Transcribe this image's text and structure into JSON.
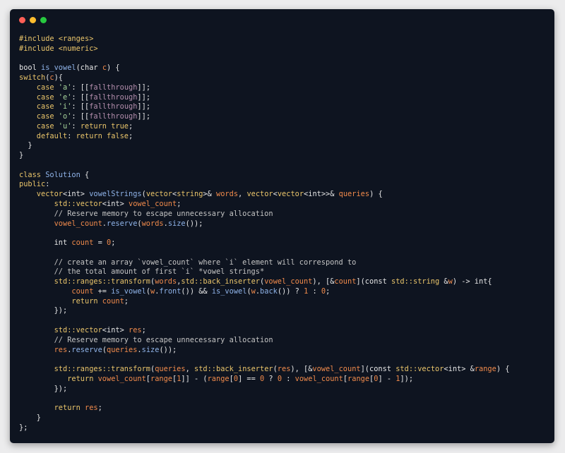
{
  "colors": {
    "background": "#ececed",
    "editor_background": "#0e1420",
    "traffic_red": "#ff5f56",
    "traffic_yellow": "#ffbd2e",
    "traffic_green": "#27c93f"
  },
  "window_controls": [
    "close",
    "minimize",
    "maximize"
  ],
  "code_lines": [
    [
      [
        "#include <ranges>",
        "kw"
      ]
    ],
    [
      [
        "#include <numeric>",
        "kw"
      ]
    ],
    [],
    [
      [
        "bool ",
        "def"
      ],
      [
        "is_vowel",
        "fn"
      ],
      [
        "(char ",
        "def"
      ],
      [
        "c",
        "var"
      ],
      [
        ") {",
        "def"
      ]
    ],
    [
      [
        "switch",
        "kw"
      ],
      [
        "(",
        "def"
      ],
      [
        "c",
        "var"
      ],
      [
        "){",
        "def"
      ]
    ],
    [
      [
        "    case ",
        "kw"
      ],
      [
        "'a'",
        "str"
      ],
      [
        ": [[",
        "def"
      ],
      [
        "fallthrough",
        "attr"
      ],
      [
        "]];",
        "def"
      ]
    ],
    [
      [
        "    case ",
        "kw"
      ],
      [
        "'e'",
        "str"
      ],
      [
        ": [[",
        "def"
      ],
      [
        "fallthrough",
        "attr"
      ],
      [
        "]];",
        "def"
      ]
    ],
    [
      [
        "    case ",
        "kw"
      ],
      [
        "'i'",
        "str"
      ],
      [
        ": [[",
        "def"
      ],
      [
        "fallthrough",
        "attr"
      ],
      [
        "]];",
        "def"
      ]
    ],
    [
      [
        "    case ",
        "kw"
      ],
      [
        "'o'",
        "str"
      ],
      [
        ": [[",
        "def"
      ],
      [
        "fallthrough",
        "attr"
      ],
      [
        "]];",
        "def"
      ]
    ],
    [
      [
        "    case ",
        "kw"
      ],
      [
        "'u'",
        "str"
      ],
      [
        ": ",
        "def"
      ],
      [
        "return true",
        "kw"
      ],
      [
        ";",
        "def"
      ]
    ],
    [
      [
        "    default",
        "kw"
      ],
      [
        ": ",
        "def"
      ],
      [
        "return false",
        "kw"
      ],
      [
        ";",
        "def"
      ]
    ],
    [
      [
        "  }",
        "def"
      ]
    ],
    [
      [
        "}",
        "def"
      ]
    ],
    [],
    [
      [
        "class ",
        "kw"
      ],
      [
        "Solution",
        "fn"
      ],
      [
        " {",
        "def"
      ]
    ],
    [
      [
        "public",
        "kw"
      ],
      [
        ":",
        "def"
      ]
    ],
    [
      [
        "    vector",
        "ns"
      ],
      [
        "<int> ",
        "def"
      ],
      [
        "vowelStrings",
        "fn"
      ],
      [
        "(",
        "def"
      ],
      [
        "vector",
        "ns"
      ],
      [
        "<",
        "def"
      ],
      [
        "string",
        "ns"
      ],
      [
        ">& ",
        "def"
      ],
      [
        "words",
        "var"
      ],
      [
        ", ",
        "def"
      ],
      [
        "vector",
        "ns"
      ],
      [
        "<",
        "def"
      ],
      [
        "vector",
        "ns"
      ],
      [
        "<int>>& ",
        "def"
      ],
      [
        "queries",
        "var"
      ],
      [
        ") {",
        "def"
      ]
    ],
    [
      [
        "        std::vector",
        "ns"
      ],
      [
        "<int> ",
        "def"
      ],
      [
        "vowel_count",
        "var"
      ],
      [
        ";",
        "def"
      ]
    ],
    [
      [
        "        // Reserve memory to escape unnecessary allocation",
        "cm"
      ]
    ],
    [
      [
        "        vowel_count",
        "var"
      ],
      [
        ".",
        "def"
      ],
      [
        "reserve",
        "fn"
      ],
      [
        "(",
        "def"
      ],
      [
        "words",
        "var"
      ],
      [
        ".",
        "def"
      ],
      [
        "size",
        "fn"
      ],
      [
        "());",
        "def"
      ]
    ],
    [],
    [
      [
        "        int ",
        "def"
      ],
      [
        "count",
        "var"
      ],
      [
        " = ",
        "def"
      ],
      [
        "0",
        "num"
      ],
      [
        ";",
        "def"
      ]
    ],
    [],
    [
      [
        "        // create an array `vowel_count` where `i` element will correspond to",
        "cm"
      ]
    ],
    [
      [
        "        // the total amount of first `i` *vowel strings*",
        "cm"
      ]
    ],
    [
      [
        "        std::ranges::transform",
        "ns"
      ],
      [
        "(",
        "def"
      ],
      [
        "words",
        "var"
      ],
      [
        ",",
        "def"
      ],
      [
        "std::back_inserter",
        "ns"
      ],
      [
        "(",
        "def"
      ],
      [
        "vowel_count",
        "var"
      ],
      [
        "), [&",
        "def"
      ],
      [
        "count",
        "var"
      ],
      [
        "](const ",
        "def"
      ],
      [
        "std::string",
        "ns"
      ],
      [
        " &",
        "def"
      ],
      [
        "w",
        "var"
      ],
      [
        ") -> int{",
        "def"
      ]
    ],
    [
      [
        "            count",
        "var"
      ],
      [
        " += ",
        "def"
      ],
      [
        "is_vowel",
        "fn"
      ],
      [
        "(",
        "def"
      ],
      [
        "w",
        "var"
      ],
      [
        ".",
        "def"
      ],
      [
        "front",
        "fn"
      ],
      [
        "()) && ",
        "def"
      ],
      [
        "is_vowel",
        "fn"
      ],
      [
        "(",
        "def"
      ],
      [
        "w",
        "var"
      ],
      [
        ".",
        "def"
      ],
      [
        "back",
        "fn"
      ],
      [
        "()) ? ",
        "def"
      ],
      [
        "1",
        "num"
      ],
      [
        " : ",
        "def"
      ],
      [
        "0",
        "num"
      ],
      [
        ";",
        "def"
      ]
    ],
    [
      [
        "            return ",
        "kw"
      ],
      [
        "count",
        "var"
      ],
      [
        ";",
        "def"
      ]
    ],
    [
      [
        "        });",
        "def"
      ]
    ],
    [],
    [
      [
        "        std::vector",
        "ns"
      ],
      [
        "<int> ",
        "def"
      ],
      [
        "res",
        "var"
      ],
      [
        ";",
        "def"
      ]
    ],
    [
      [
        "        // Reserve memory to escape unnecessary allocation",
        "cm"
      ]
    ],
    [
      [
        "        res",
        "var"
      ],
      [
        ".",
        "def"
      ],
      [
        "reserve",
        "fn"
      ],
      [
        "(",
        "def"
      ],
      [
        "queries",
        "var"
      ],
      [
        ".",
        "def"
      ],
      [
        "size",
        "fn"
      ],
      [
        "());",
        "def"
      ]
    ],
    [],
    [
      [
        "        std::ranges::transform",
        "ns"
      ],
      [
        "(",
        "def"
      ],
      [
        "queries",
        "var"
      ],
      [
        ", ",
        "def"
      ],
      [
        "std::back_inserter",
        "ns"
      ],
      [
        "(",
        "def"
      ],
      [
        "res",
        "var"
      ],
      [
        "), [&",
        "def"
      ],
      [
        "vowel_count",
        "var"
      ],
      [
        "](const ",
        "def"
      ],
      [
        "std::vector",
        "ns"
      ],
      [
        "<int> &",
        "def"
      ],
      [
        "range",
        "var"
      ],
      [
        ") {",
        "def"
      ]
    ],
    [
      [
        "           return ",
        "kw"
      ],
      [
        "vowel_count",
        "var"
      ],
      [
        "[",
        "def"
      ],
      [
        "range",
        "var"
      ],
      [
        "[",
        "def"
      ],
      [
        "1",
        "num"
      ],
      [
        "]] - (",
        "def"
      ],
      [
        "range",
        "var"
      ],
      [
        "[",
        "def"
      ],
      [
        "0",
        "num"
      ],
      [
        "] == ",
        "def"
      ],
      [
        "0",
        "num"
      ],
      [
        " ? ",
        "def"
      ],
      [
        "0",
        "num"
      ],
      [
        " : ",
        "def"
      ],
      [
        "vowel_count",
        "var"
      ],
      [
        "[",
        "def"
      ],
      [
        "range",
        "var"
      ],
      [
        "[",
        "def"
      ],
      [
        "0",
        "num"
      ],
      [
        "] - ",
        "def"
      ],
      [
        "1",
        "num"
      ],
      [
        "]);",
        "def"
      ]
    ],
    [
      [
        "        });",
        "def"
      ]
    ],
    [],
    [
      [
        "        return ",
        "kw"
      ],
      [
        "res",
        "var"
      ],
      [
        ";",
        "def"
      ]
    ],
    [
      [
        "    }",
        "def"
      ]
    ],
    [
      [
        "};",
        "def"
      ]
    ]
  ]
}
